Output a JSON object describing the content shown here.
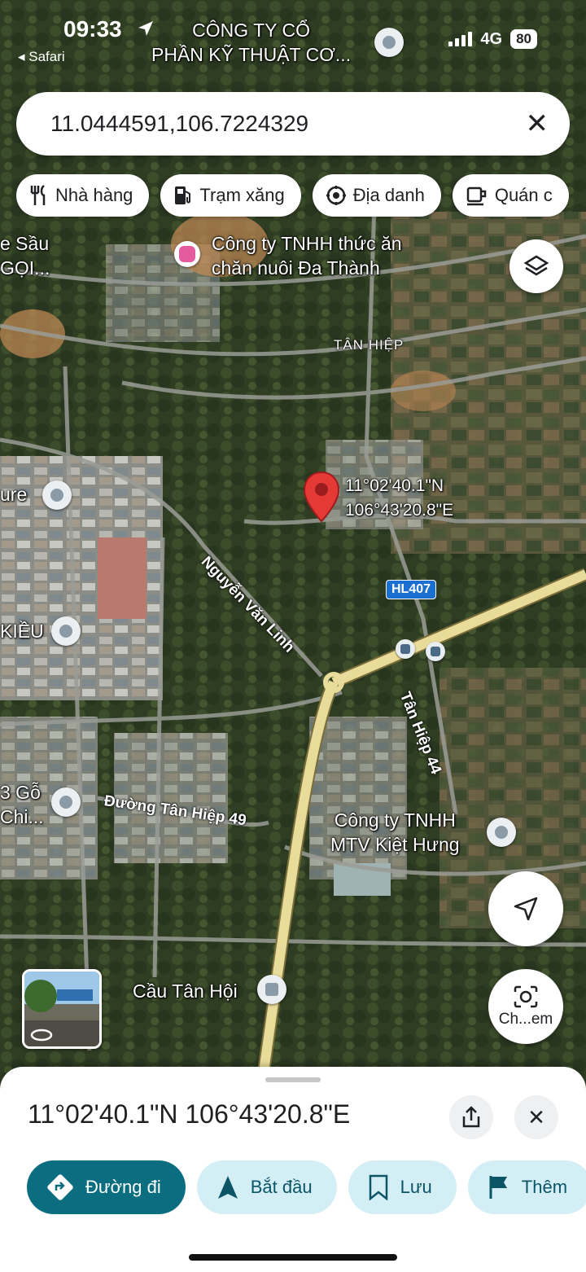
{
  "status_bar": {
    "time": "09:33",
    "back_app": "Safari",
    "network": "4G",
    "battery": "80"
  },
  "search": {
    "query": "11.0444591,106.7224329"
  },
  "chips": [
    {
      "label": "Nhà hàng",
      "icon": "restaurant-icon"
    },
    {
      "label": "Trạm xăng",
      "icon": "gas-station-icon"
    },
    {
      "label": "Địa danh",
      "icon": "landmark-icon"
    },
    {
      "label": "Quán c",
      "icon": "cafe-icon"
    }
  ],
  "map": {
    "top_poi": "CÔNG TY CỔ\nPHẦN KỸ THUẬT CƠ...",
    "left_poi_1": "e Sầu\nGỌI...",
    "hotel_poi": "Công ty TNHH thức ăn\nchăn nuôi Đa Thành",
    "area": "TÂN HIỆP",
    "left_poi_2": "ure",
    "left_poi_3": "KIỀU",
    "left_poi_4": "3 Gỗ\nChi...",
    "pin_coords": "11°02'40.1\"N\n106°43'20.8\"E",
    "route_shield": "HL407",
    "road_1": "Nguyễn Văn Linh",
    "road_2": "Tân Hiệp 44",
    "road_3": "Đường Tân Hiệp 49",
    "poi_kiet_hung": "Công ty TNHH\nMTV Kiệt Hưng",
    "poi_bridge": "Cầu Tân Hội",
    "lens_label": "Ch...em"
  },
  "sheet": {
    "title": "11°02'40.1\"N 106°43'20.8\"E",
    "actions": [
      {
        "label": "Đường đi",
        "icon": "directions-icon"
      },
      {
        "label": "Bắt đầu",
        "icon": "navigation-arrow-icon"
      },
      {
        "label": "Lưu",
        "icon": "bookmark-icon"
      },
      {
        "label": "Thêm",
        "icon": "flag-icon"
      }
    ]
  },
  "colors": {
    "primary": "#0b6e80",
    "secondary": "#d4eef5",
    "pin": "#e53935",
    "road_major": "#e9dc9a",
    "shield": "#1a6fd1"
  }
}
